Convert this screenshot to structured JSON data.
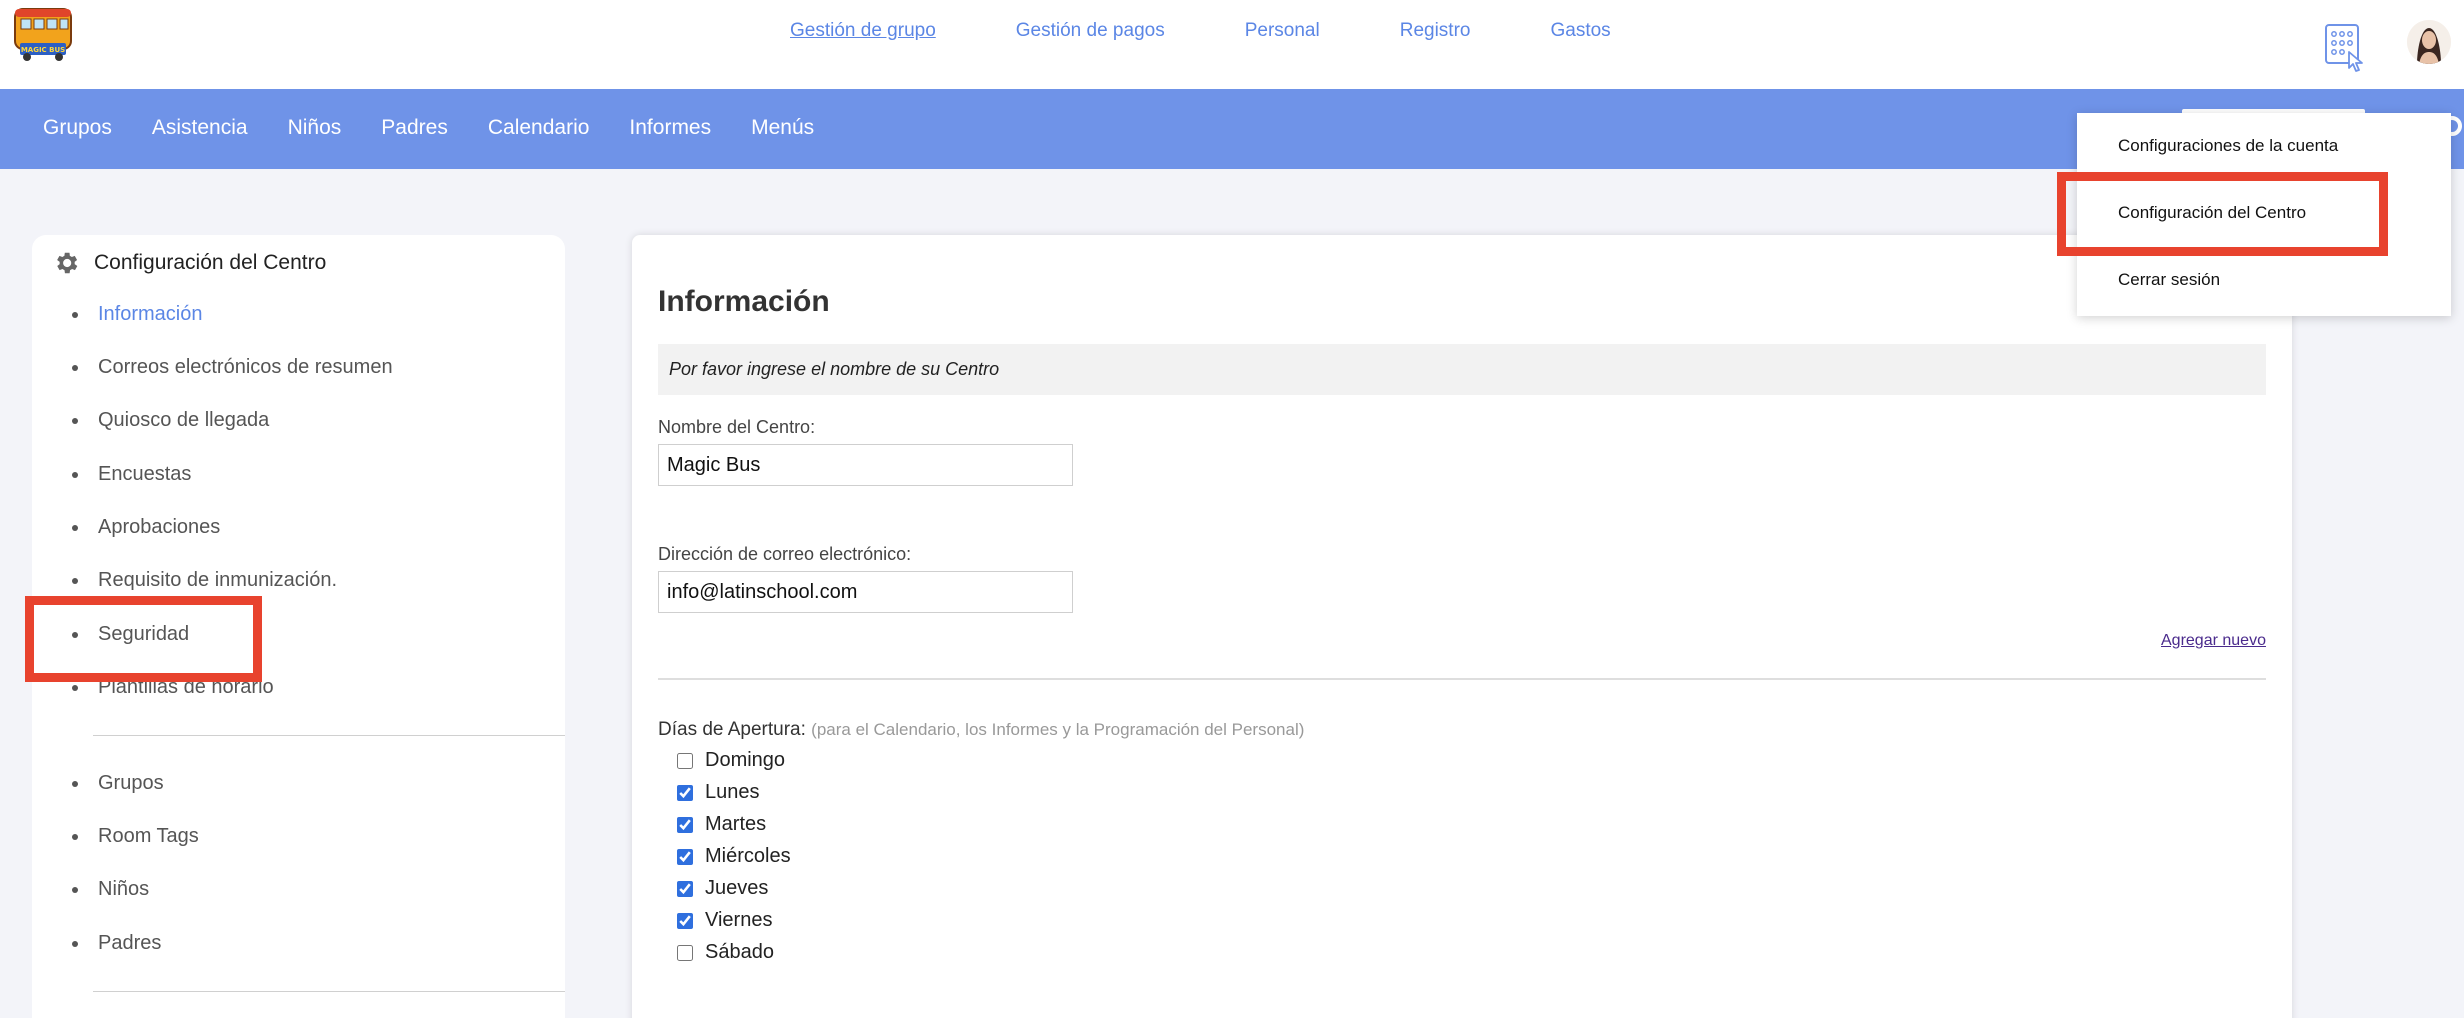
{
  "header": {
    "logo_text": "MAGIC BUS",
    "nav": [
      {
        "label": "Gestión de grupo",
        "active": true
      },
      {
        "label": "Gestión de pagos",
        "active": false
      },
      {
        "label": "Personal",
        "active": false
      },
      {
        "label": "Registro",
        "active": false
      },
      {
        "label": "Gastos",
        "active": false
      }
    ],
    "link_color": "#5b86e5"
  },
  "main_nav": {
    "items": [
      "Grupos",
      "Asistencia",
      "Niños",
      "Padres",
      "Calendario",
      "Informes",
      "Menús"
    ],
    "bg_color": "#6f93e8"
  },
  "sidebar": {
    "title": "Configuración del Centro",
    "section1": [
      {
        "label": "Información",
        "active": true
      },
      {
        "label": "Correos electrónicos de resumen"
      },
      {
        "label": "Quiosco de llegada"
      },
      {
        "label": "Encuestas"
      },
      {
        "label": "Aprobaciones"
      },
      {
        "label": "Requisito de inmunización."
      },
      {
        "label": "Seguridad"
      },
      {
        "label": "Plantillas de horario"
      }
    ],
    "section2": [
      {
        "label": "Grupos"
      },
      {
        "label": "Room Tags"
      },
      {
        "label": "Niños"
      },
      {
        "label": "Padres"
      }
    ]
  },
  "panel": {
    "title": "Información",
    "hint": "Por favor ingrese el nombre de su Centro",
    "center_name_label": "Nombre del Centro:",
    "center_name_value": "Magic Bus",
    "email_label": "Dirección de correo electrónico:",
    "email_value": "info@latinschool.com",
    "add_new": "Agregar nuevo",
    "days_label": "Días de Apertura:",
    "days_sub": "(para el Calendario, los Informes y la Programación del Personal)",
    "days": [
      {
        "label": "Domingo",
        "checked": false
      },
      {
        "label": "Lunes",
        "checked": true
      },
      {
        "label": "Martes",
        "checked": true
      },
      {
        "label": "Miércoles",
        "checked": true
      },
      {
        "label": "Jueves",
        "checked": true
      },
      {
        "label": "Viernes",
        "checked": true
      },
      {
        "label": "Sábado",
        "checked": false
      }
    ]
  },
  "dropdown": {
    "items": [
      "Configuraciones de la cuenta",
      "Configuración del Centro",
      "Cerrar sesión"
    ]
  },
  "highlight_color": "#e8432e"
}
